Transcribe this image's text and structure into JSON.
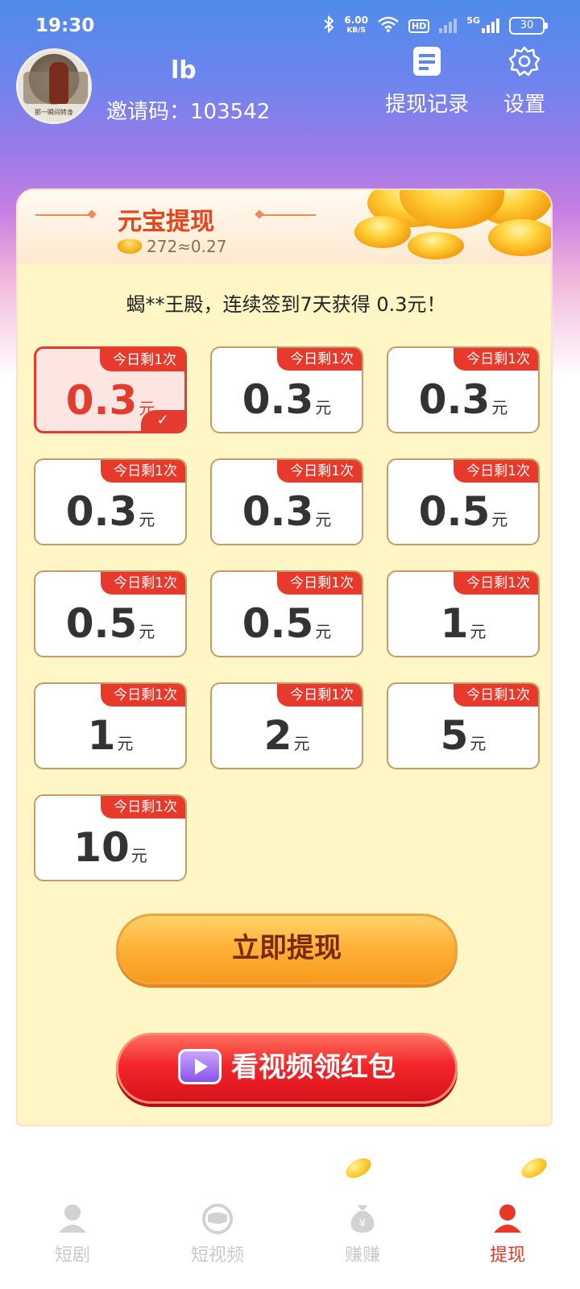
{
  "status_bar": {
    "time": "19:30",
    "net_speed_value": "6.00",
    "net_speed_unit": "KB/S",
    "hd_label": "HD",
    "network_type": "5G",
    "battery": "30"
  },
  "header": {
    "username": "lb",
    "invite_label": "邀请码：",
    "invite_code": "103542",
    "records_label": "提现记录",
    "settings_label": "设置",
    "avatar_caption": "那一瞬间转身"
  },
  "card": {
    "title": "元宝提现",
    "balance": "272≈0.27",
    "ticker": "蝎**王殿，连续签到7天获得 0.3元！"
  },
  "options": {
    "badge": "今日剩1次",
    "unit": "元",
    "items": [
      {
        "value": "0.3",
        "selected": true
      },
      {
        "value": "0.3"
      },
      {
        "value": "0.3"
      },
      {
        "value": "0.3"
      },
      {
        "value": "0.3"
      },
      {
        "value": "0.5"
      },
      {
        "value": "0.5"
      },
      {
        "value": "0.5"
      },
      {
        "value": "1"
      },
      {
        "value": "1"
      },
      {
        "value": "2"
      },
      {
        "value": "5"
      },
      {
        "value": "10"
      }
    ]
  },
  "buttons": {
    "withdraw": "立即提现",
    "watch_video": "看视频领红包"
  },
  "bottom_nav": [
    {
      "label": "短剧",
      "icon": "person-icon"
    },
    {
      "label": "短视频",
      "icon": "tv-face-icon"
    },
    {
      "label": "赚赚",
      "icon": "money-bag-icon"
    },
    {
      "label": "提现",
      "icon": "person-icon",
      "active": true
    }
  ],
  "colors": {
    "accent_red": "#e53a2e",
    "title_orange": "#e5441e",
    "card_bg": "#fff6c6",
    "header_blue": "#4f8bea"
  }
}
